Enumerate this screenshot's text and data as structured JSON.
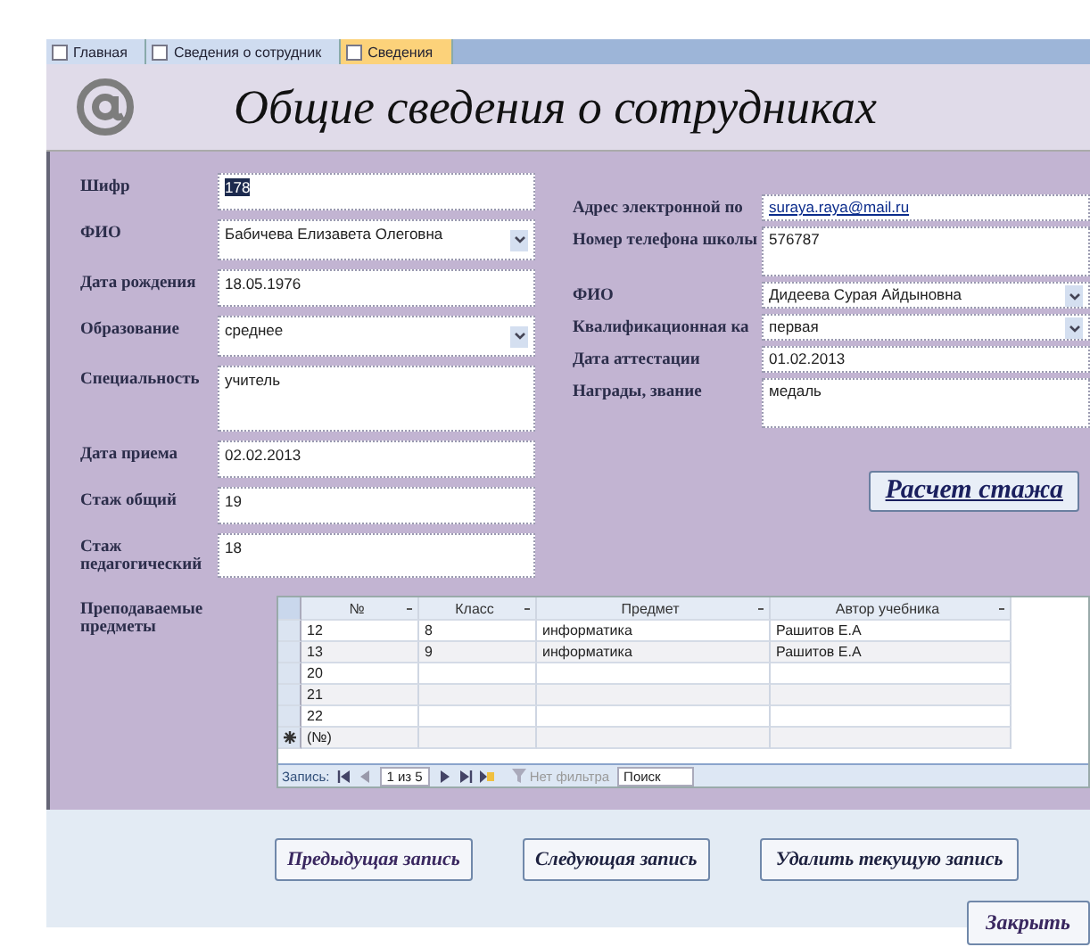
{
  "tabs": [
    {
      "label": "Главная",
      "selected": false
    },
    {
      "label": "Сведения о сотрудник",
      "selected": false
    },
    {
      "label": "Сведения",
      "selected": true
    }
  ],
  "header": {
    "title": "Общие сведения о сотрудниках"
  },
  "left_fields": [
    {
      "label": "Шифр",
      "kind": "text",
      "value": "178",
      "highlighted": true
    },
    {
      "label": "ФИО",
      "kind": "combo",
      "value": "Бабичева Елизавета Олеговна"
    },
    {
      "label": "Дата рождения",
      "kind": "text",
      "value": "18.05.1976"
    },
    {
      "label": "Образование",
      "kind": "combo",
      "value": "среднее"
    },
    {
      "label": "Специальность",
      "kind": "memo",
      "value": "учитель"
    },
    {
      "label": "Дата приема",
      "kind": "text",
      "value": "02.02.2013"
    },
    {
      "label": "Стаж общий",
      "kind": "text",
      "value": "19"
    },
    {
      "label": "Стаж педагогический",
      "kind": "text",
      "value": "18"
    }
  ],
  "right_fields": [
    {
      "label": "Адрес электронной по",
      "kind": "link",
      "value": "suraya.raya@mail.ru"
    },
    {
      "label": "Номер телефона школы",
      "kind": "memo",
      "value": "576787"
    },
    {
      "label": "ФИО",
      "kind": "combo",
      "value": "Дидеева Сурая Айдыновна"
    },
    {
      "label": "Квалификационная ка",
      "kind": "combo",
      "value": "первая"
    },
    {
      "label": "Дата аттестации",
      "kind": "text",
      "value": "01.02.2013"
    },
    {
      "label": "Награды, звание",
      "kind": "memo",
      "value": "медаль"
    }
  ],
  "calc_button": "Расчет стажа",
  "subform": {
    "label": "Преподаваемые предметы",
    "columns": [
      "№",
      "Класс",
      "Предмет",
      "Автор учебника"
    ],
    "rows": [
      {
        "kind": "record",
        "cells": [
          "12",
          "8",
          "информатика",
          "Рашитов Е.А"
        ]
      },
      {
        "kind": "record",
        "cells": [
          "13",
          "9",
          "информатика",
          "Рашитов Е.А"
        ]
      },
      {
        "kind": "record",
        "cells": [
          "20",
          "",
          "",
          ""
        ]
      },
      {
        "kind": "record",
        "cells": [
          "21",
          "",
          "",
          ""
        ]
      },
      {
        "kind": "record",
        "cells": [
          "22",
          "",
          "",
          ""
        ]
      },
      {
        "kind": "new",
        "cells": [
          "(№)",
          "",
          "",
          ""
        ]
      }
    ],
    "nav": {
      "label": "Запись:",
      "position": "1 из 5",
      "filter": "Нет фильтра",
      "search": "Поиск"
    }
  },
  "buttons": [
    "Предыдущая запись",
    "Следующая запись",
    "Удалить текущую запись"
  ],
  "close_button": "Закрыть"
}
